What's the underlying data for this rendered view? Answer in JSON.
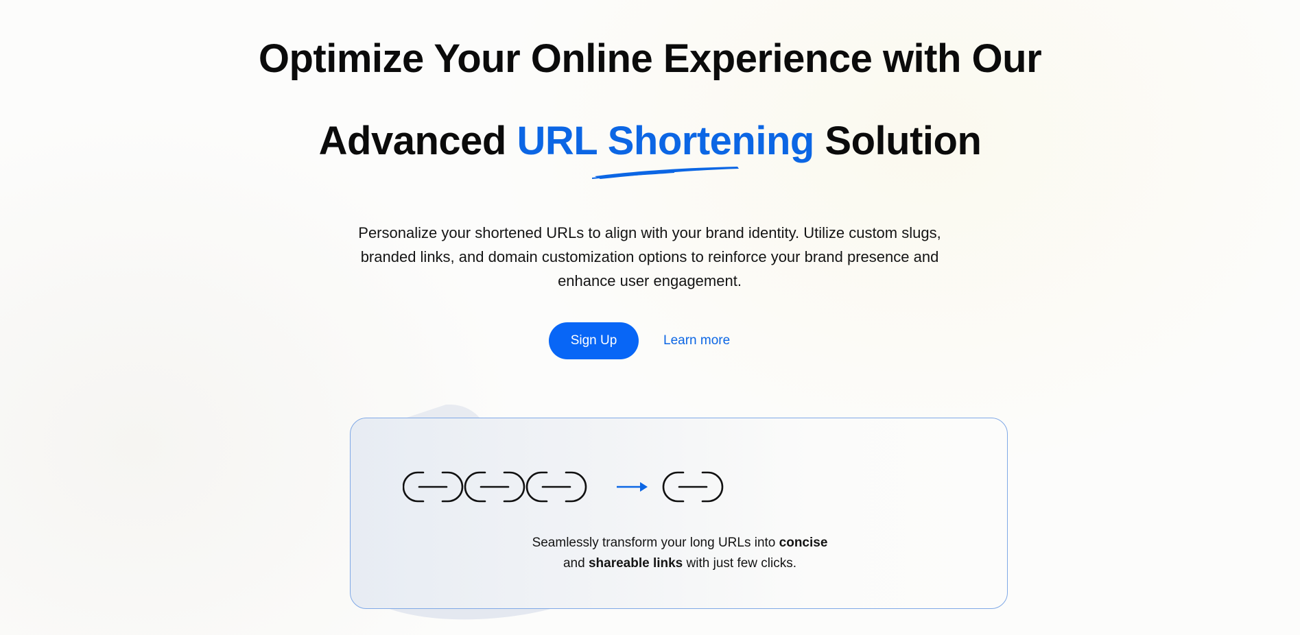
{
  "hero": {
    "headline_line1": "Optimize Your Online Experience with Our",
    "headline_line2_prefix": "Advanced ",
    "headline_line2_highlight": "URL Shortening",
    "headline_line2_suffix": " Solution",
    "description_line1": "Personalize your shortened URLs to align with your brand identity. Utilize custom slugs,",
    "description_line2": "branded links, and domain customization options to reinforce your brand presence and",
    "description_line3": "enhance user engagement.",
    "signup_label": "Sign Up",
    "learn_more_label": "Learn more"
  },
  "card": {
    "long_link_icons": [
      "link-icon",
      "link-icon",
      "link-icon"
    ],
    "arrow_icon": "arrow-right-icon",
    "short_link_icon": "link-icon",
    "caption_line1_part1": "Seamlessly transform your long URLs into ",
    "caption_line1_bold": "concise",
    "caption_line2_part1": "and ",
    "caption_line2_bold": "shareable links",
    "caption_line2_part2": " with just few clicks."
  },
  "colors": {
    "accent": "#0866f6",
    "highlight_text": "#0c66e4",
    "card_border": "#7fa8e6",
    "text": "#0b0b0b"
  }
}
